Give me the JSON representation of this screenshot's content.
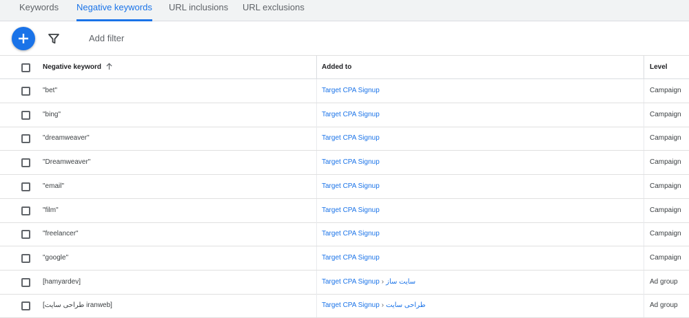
{
  "tabs": [
    {
      "label": "Keywords",
      "active": false
    },
    {
      "label": "Negative keywords",
      "active": true
    },
    {
      "label": "URL inclusions",
      "active": false
    },
    {
      "label": "URL exclusions",
      "active": false
    }
  ],
  "toolbar": {
    "add_icon": "plus-icon",
    "filter_icon": "filter-funnel-icon",
    "add_filter_label": "Add filter"
  },
  "table": {
    "columns": {
      "keyword": "Negative keyword",
      "added_to": "Added to",
      "level": "Level"
    },
    "sort_icon": "arrow-up-icon",
    "rows": [
      {
        "keyword": "\"bet\"",
        "campaign": "Target CPA Signup",
        "ad_group": null,
        "level": "Campaign"
      },
      {
        "keyword": "\"bing\"",
        "campaign": "Target CPA Signup",
        "ad_group": null,
        "level": "Campaign"
      },
      {
        "keyword": "\"dreamweaver\"",
        "campaign": "Target CPA Signup",
        "ad_group": null,
        "level": "Campaign"
      },
      {
        "keyword": "\"Dreamweaver\"",
        "campaign": "Target CPA Signup",
        "ad_group": null,
        "level": "Campaign"
      },
      {
        "keyword": "\"email\"",
        "campaign": "Target CPA Signup",
        "ad_group": null,
        "level": "Campaign"
      },
      {
        "keyword": "\"film\"",
        "campaign": "Target CPA Signup",
        "ad_group": null,
        "level": "Campaign"
      },
      {
        "keyword": "\"freelancer\"",
        "campaign": "Target CPA Signup",
        "ad_group": null,
        "level": "Campaign"
      },
      {
        "keyword": "\"google\"",
        "campaign": "Target CPA Signup",
        "ad_group": null,
        "level": "Campaign"
      },
      {
        "keyword": "[hamyardev]",
        "campaign": "Target CPA Signup",
        "ad_group": "سایت ساز",
        "level": "Ad group"
      },
      {
        "keyword": "[طراحی سایت iranweb]",
        "campaign": "Target CPA Signup",
        "ad_group": "طراحی سایت",
        "level": "Ad group"
      }
    ]
  },
  "colors": {
    "accent": "#1a73e8",
    "background": "#f1f3f4",
    "text": "#3c4043"
  }
}
